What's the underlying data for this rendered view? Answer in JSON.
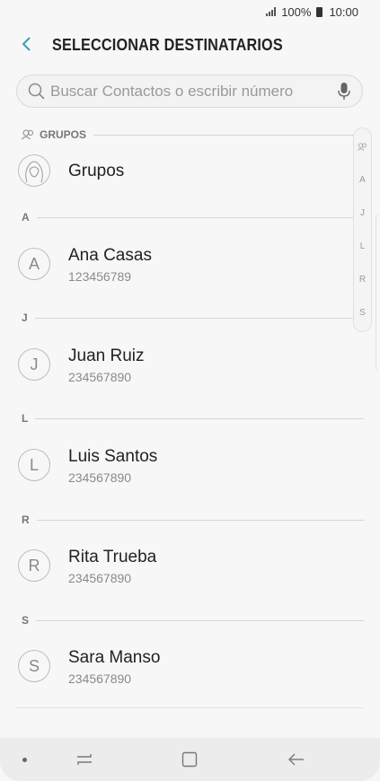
{
  "status": {
    "battery": "100%",
    "time": "10:00"
  },
  "header": {
    "title": "SELECCIONAR DESTINATARIOS"
  },
  "search": {
    "placeholder": "Buscar Contactos o escribir número"
  },
  "groups": {
    "section_label": "GRUPOS",
    "item_label": "Grupos"
  },
  "sections": [
    {
      "letter": "A",
      "contacts": [
        {
          "name": "Ana Casas",
          "number": "123456789",
          "initial": "A"
        }
      ]
    },
    {
      "letter": "J",
      "contacts": [
        {
          "name": "Juan Ruiz",
          "number": "234567890",
          "initial": "J"
        }
      ]
    },
    {
      "letter": "L",
      "contacts": [
        {
          "name": "Luis Santos",
          "number": "234567890",
          "initial": "L"
        }
      ]
    },
    {
      "letter": "R",
      "contacts": [
        {
          "name": "Rita Trueba",
          "number": "234567890",
          "initial": "R"
        }
      ]
    },
    {
      "letter": "S",
      "contacts": [
        {
          "name": "Sara Manso",
          "number": "234567890",
          "initial": "S"
        }
      ]
    }
  ],
  "index_letters": [
    "A",
    "J",
    "L",
    "R",
    "S"
  ],
  "colors": {
    "accent": "#3a9fb4",
    "navbar": "#ececec"
  }
}
